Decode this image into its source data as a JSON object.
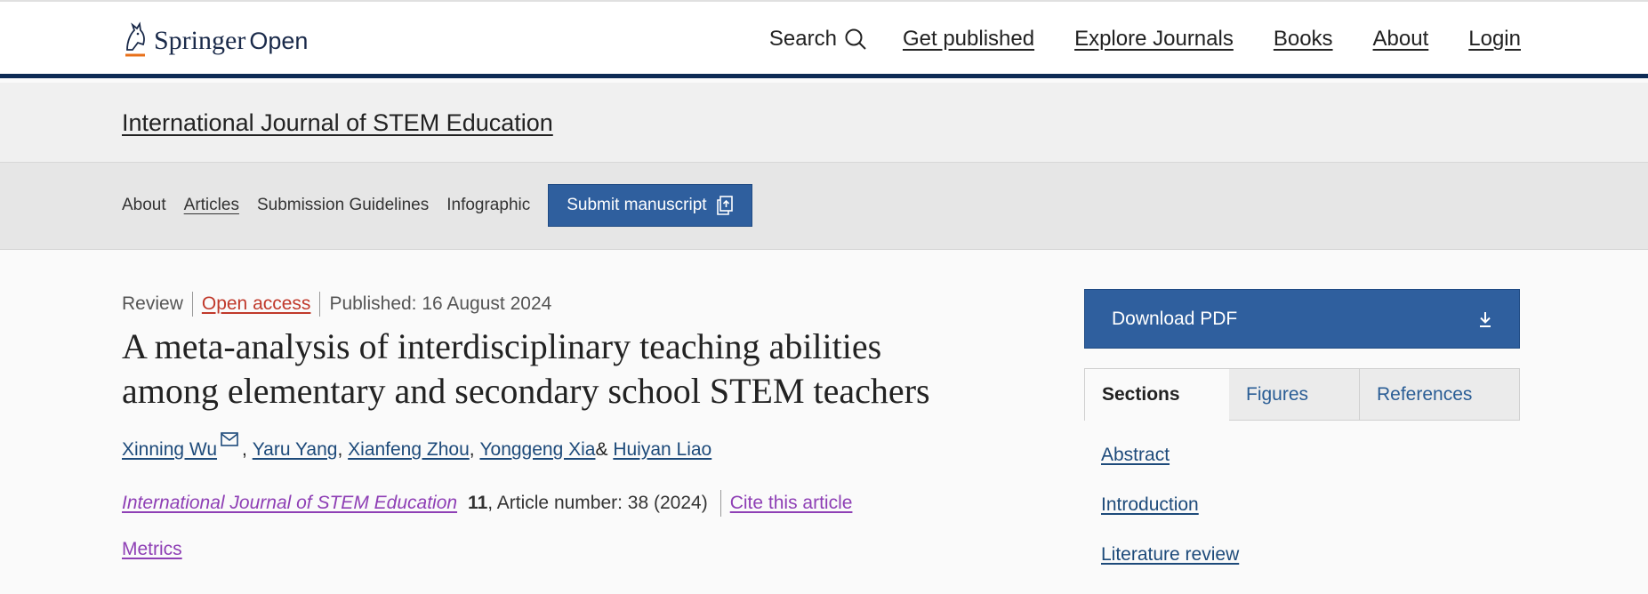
{
  "header": {
    "logo": {
      "brand": "Springer",
      "suffix": "Open"
    },
    "search_label": "Search",
    "nav": [
      "Get published",
      "Explore Journals",
      "Books",
      "About",
      "Login"
    ]
  },
  "journal": {
    "title": "International Journal of STEM Education",
    "nav": {
      "about": "About",
      "articles": "Articles",
      "guidelines": "Submission Guidelines",
      "infographic": "Infographic",
      "submit": "Submit manuscript"
    }
  },
  "article": {
    "type": "Review",
    "access": "Open access",
    "published": "Published: 16 August 2024",
    "title": "A meta-analysis of interdisciplinary teaching abilities among elementary and secondary school STEM teachers",
    "authors": [
      {
        "name": "Xinning Wu",
        "sep": ","
      },
      {
        "name": "Yaru Yang",
        "sep": ","
      },
      {
        "name": "Xianfeng Zhou",
        "sep": ","
      },
      {
        "name": "Yonggeng Xia",
        "sep": " &"
      },
      {
        "name": "Huiyan Liao",
        "sep": ""
      }
    ],
    "citation": {
      "journal": "International Journal of STEM Education",
      "volume": "11",
      "rest": ", Article number: 38 (2024)",
      "cite_link": "Cite this article"
    },
    "metrics": "Metrics"
  },
  "sidebar": {
    "download": "Download PDF",
    "tabs": [
      "Sections",
      "Figures",
      "References"
    ],
    "sections": [
      "Abstract",
      "Introduction",
      "Literature review"
    ]
  },
  "colors": {
    "navy_rule": "#0d2b55",
    "button_blue": "#2f5f9e",
    "link_blue": "#1d4a7a",
    "open_access_red": "#c0392b",
    "visited_purple": "#8e3fb5"
  }
}
